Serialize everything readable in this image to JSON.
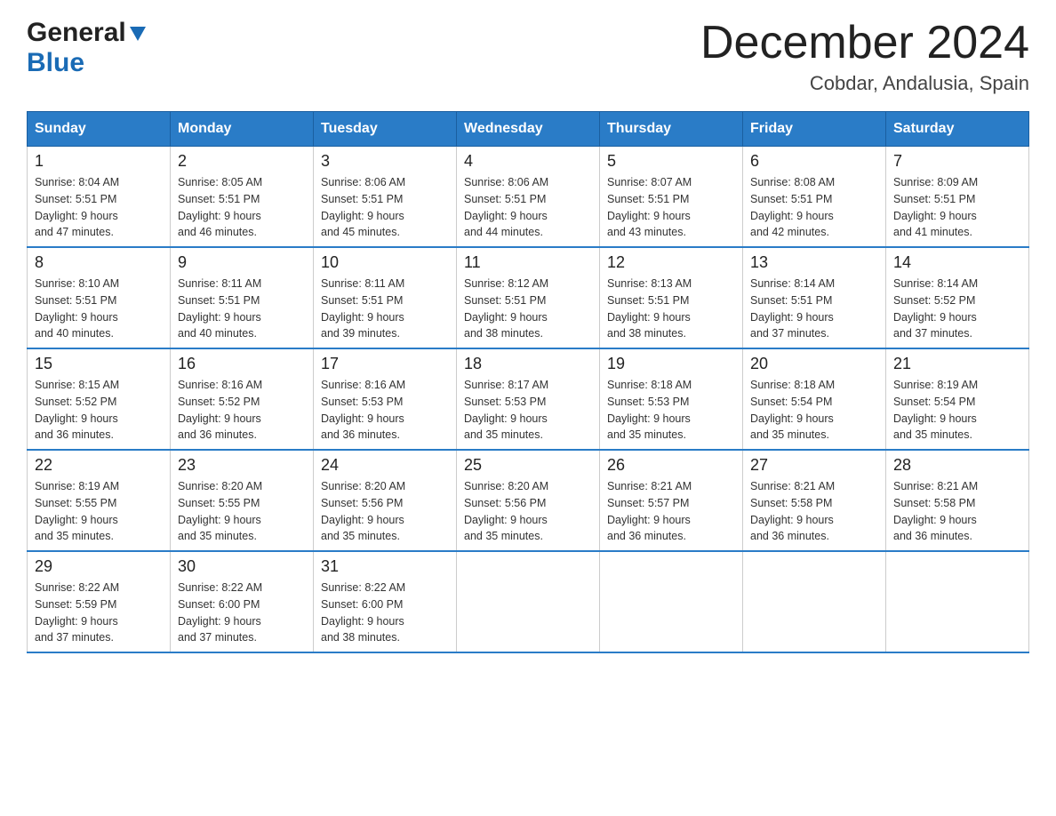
{
  "logo": {
    "general": "General",
    "blue": "Blue"
  },
  "header": {
    "month_year": "December 2024",
    "location": "Cobdar, Andalusia, Spain"
  },
  "weekdays": [
    "Sunday",
    "Monday",
    "Tuesday",
    "Wednesday",
    "Thursday",
    "Friday",
    "Saturday"
  ],
  "weeks": [
    [
      {
        "day": "1",
        "sunrise": "8:04 AM",
        "sunset": "5:51 PM",
        "daylight": "9 hours and 47 minutes."
      },
      {
        "day": "2",
        "sunrise": "8:05 AM",
        "sunset": "5:51 PM",
        "daylight": "9 hours and 46 minutes."
      },
      {
        "day": "3",
        "sunrise": "8:06 AM",
        "sunset": "5:51 PM",
        "daylight": "9 hours and 45 minutes."
      },
      {
        "day": "4",
        "sunrise": "8:06 AM",
        "sunset": "5:51 PM",
        "daylight": "9 hours and 44 minutes."
      },
      {
        "day": "5",
        "sunrise": "8:07 AM",
        "sunset": "5:51 PM",
        "daylight": "9 hours and 43 minutes."
      },
      {
        "day": "6",
        "sunrise": "8:08 AM",
        "sunset": "5:51 PM",
        "daylight": "9 hours and 42 minutes."
      },
      {
        "day": "7",
        "sunrise": "8:09 AM",
        "sunset": "5:51 PM",
        "daylight": "9 hours and 41 minutes."
      }
    ],
    [
      {
        "day": "8",
        "sunrise": "8:10 AM",
        "sunset": "5:51 PM",
        "daylight": "9 hours and 40 minutes."
      },
      {
        "day": "9",
        "sunrise": "8:11 AM",
        "sunset": "5:51 PM",
        "daylight": "9 hours and 40 minutes."
      },
      {
        "day": "10",
        "sunrise": "8:11 AM",
        "sunset": "5:51 PM",
        "daylight": "9 hours and 39 minutes."
      },
      {
        "day": "11",
        "sunrise": "8:12 AM",
        "sunset": "5:51 PM",
        "daylight": "9 hours and 38 minutes."
      },
      {
        "day": "12",
        "sunrise": "8:13 AM",
        "sunset": "5:51 PM",
        "daylight": "9 hours and 38 minutes."
      },
      {
        "day": "13",
        "sunrise": "8:14 AM",
        "sunset": "5:51 PM",
        "daylight": "9 hours and 37 minutes."
      },
      {
        "day": "14",
        "sunrise": "8:14 AM",
        "sunset": "5:52 PM",
        "daylight": "9 hours and 37 minutes."
      }
    ],
    [
      {
        "day": "15",
        "sunrise": "8:15 AM",
        "sunset": "5:52 PM",
        "daylight": "9 hours and 36 minutes."
      },
      {
        "day": "16",
        "sunrise": "8:16 AM",
        "sunset": "5:52 PM",
        "daylight": "9 hours and 36 minutes."
      },
      {
        "day": "17",
        "sunrise": "8:16 AM",
        "sunset": "5:53 PM",
        "daylight": "9 hours and 36 minutes."
      },
      {
        "day": "18",
        "sunrise": "8:17 AM",
        "sunset": "5:53 PM",
        "daylight": "9 hours and 35 minutes."
      },
      {
        "day": "19",
        "sunrise": "8:18 AM",
        "sunset": "5:53 PM",
        "daylight": "9 hours and 35 minutes."
      },
      {
        "day": "20",
        "sunrise": "8:18 AM",
        "sunset": "5:54 PM",
        "daylight": "9 hours and 35 minutes."
      },
      {
        "day": "21",
        "sunrise": "8:19 AM",
        "sunset": "5:54 PM",
        "daylight": "9 hours and 35 minutes."
      }
    ],
    [
      {
        "day": "22",
        "sunrise": "8:19 AM",
        "sunset": "5:55 PM",
        "daylight": "9 hours and 35 minutes."
      },
      {
        "day": "23",
        "sunrise": "8:20 AM",
        "sunset": "5:55 PM",
        "daylight": "9 hours and 35 minutes."
      },
      {
        "day": "24",
        "sunrise": "8:20 AM",
        "sunset": "5:56 PM",
        "daylight": "9 hours and 35 minutes."
      },
      {
        "day": "25",
        "sunrise": "8:20 AM",
        "sunset": "5:56 PM",
        "daylight": "9 hours and 35 minutes."
      },
      {
        "day": "26",
        "sunrise": "8:21 AM",
        "sunset": "5:57 PM",
        "daylight": "9 hours and 36 minutes."
      },
      {
        "day": "27",
        "sunrise": "8:21 AM",
        "sunset": "5:58 PM",
        "daylight": "9 hours and 36 minutes."
      },
      {
        "day": "28",
        "sunrise": "8:21 AM",
        "sunset": "5:58 PM",
        "daylight": "9 hours and 36 minutes."
      }
    ],
    [
      {
        "day": "29",
        "sunrise": "8:22 AM",
        "sunset": "5:59 PM",
        "daylight": "9 hours and 37 minutes."
      },
      {
        "day": "30",
        "sunrise": "8:22 AM",
        "sunset": "6:00 PM",
        "daylight": "9 hours and 37 minutes."
      },
      {
        "day": "31",
        "sunrise": "8:22 AM",
        "sunset": "6:00 PM",
        "daylight": "9 hours and 38 minutes."
      },
      null,
      null,
      null,
      null
    ]
  ],
  "labels": {
    "sunrise": "Sunrise:",
    "sunset": "Sunset:",
    "daylight": "Daylight:"
  }
}
